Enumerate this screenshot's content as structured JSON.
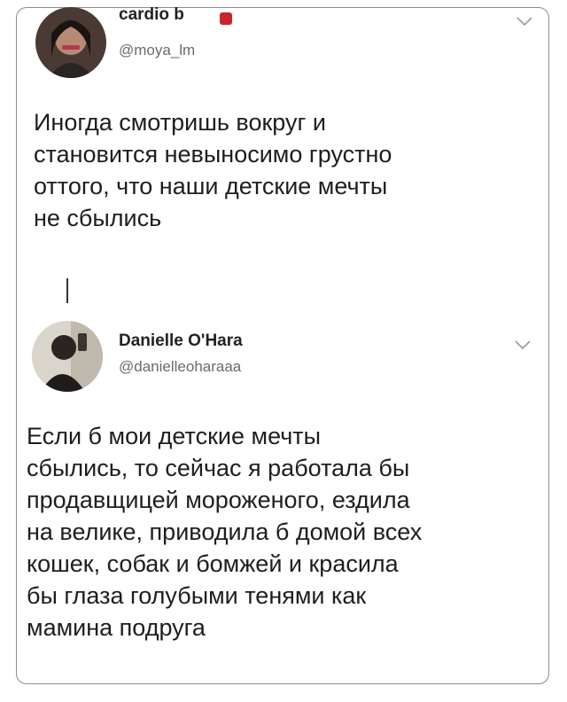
{
  "tweet_original": {
    "display_name": "cardio b",
    "handle": "@moya_lm",
    "text_lines": [
      "Иногда смотришь вокруг и",
      "становится невыносимо грустно",
      "оттого, что наши детские мечты",
      "не сбылись"
    ]
  },
  "tweet_reply": {
    "display_name": "Danielle O'Hara",
    "handle": "@danielleoharaaa",
    "text_lines": [
      "Если б мои детские мечты",
      "сбылись, то сейчас я работала бы",
      "продавщицей мороженого, ездила",
      "на велике, приводила б домой всех",
      "кошек, собак и бомжей и красила",
      "бы глаза голубыми тенями как",
      "мамина подруга"
    ]
  },
  "icons": {
    "menu_chevron": "chevron-down-icon",
    "verified_flag": "flag-badge-icon"
  },
  "colors": {
    "text": "#1e1e1e",
    "handle": "#6a6a6a",
    "border": "#8c8c8c"
  }
}
